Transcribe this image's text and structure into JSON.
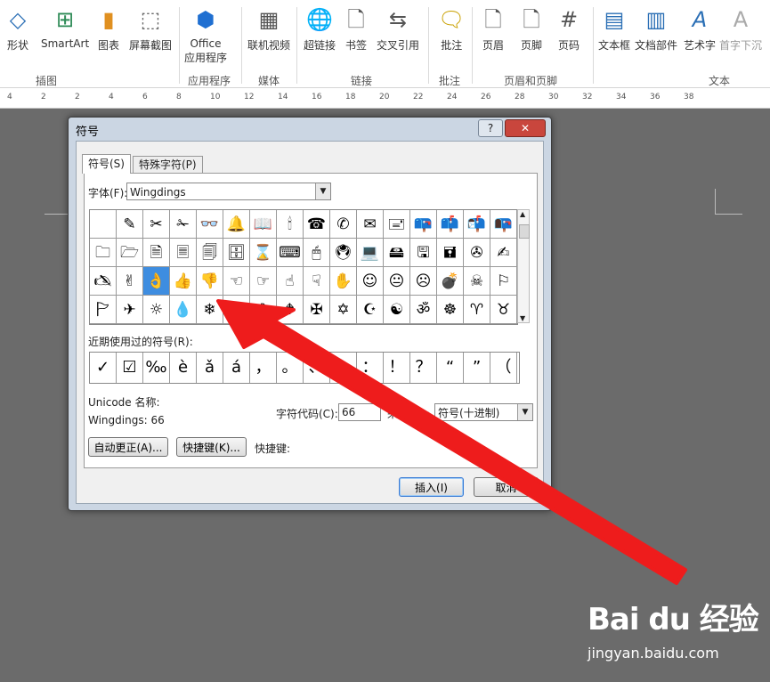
{
  "ribbon": {
    "buttons": [
      {
        "label": "形状",
        "icon": "shapes-icon"
      },
      {
        "label": "SmartArt",
        "icon": "smartart-icon"
      },
      {
        "label": "图表",
        "icon": "chart-icon"
      },
      {
        "label": "屏幕截图",
        "icon": "screenshot-icon"
      },
      {
        "label": "Office",
        "label2": "应用程序",
        "icon": "office-apps-icon"
      },
      {
        "label": "联机视频",
        "icon": "video-icon"
      },
      {
        "label": "超链接",
        "icon": "hyperlink-icon"
      },
      {
        "label": "书签",
        "icon": "bookmark-icon"
      },
      {
        "label": "交叉引用",
        "icon": "cross-reference-icon"
      },
      {
        "label": "批注",
        "icon": "comment-icon"
      },
      {
        "label": "页眉",
        "icon": "header-icon"
      },
      {
        "label": "页脚",
        "icon": "footer-icon"
      },
      {
        "label": "页码",
        "icon": "page-number-icon"
      },
      {
        "label": "文本框",
        "icon": "textbox-icon"
      },
      {
        "label": "文档部件",
        "icon": "quick-parts-icon"
      },
      {
        "label": "艺术字",
        "icon": "wordart-icon"
      },
      {
        "label": "首字下沉",
        "icon": "drop-cap-icon"
      }
    ],
    "groups": [
      "插图",
      "应用程序",
      "媒体",
      "链接",
      "批注",
      "页眉和页脚",
      "文本"
    ]
  },
  "ruler": {
    "ticks": [
      "4",
      "2",
      "2",
      "4",
      "6",
      "8",
      "10",
      "12",
      "14",
      "16",
      "18",
      "20",
      "22",
      "24",
      "26",
      "28",
      "30",
      "32",
      "34",
      "36",
      "38"
    ]
  },
  "dialog": {
    "title": "符号",
    "help_label": "?",
    "close_label": "✕",
    "tabs": [
      "符号(S)",
      "特殊字符(P)"
    ],
    "font_label": "字体(F):",
    "font_value": "Wingdings",
    "symbols": [
      "",
      "✎",
      "✂",
      "✁",
      "👓",
      "🔔",
      "📖",
      "🕯",
      "☎",
      "✆",
      "✉",
      "🖃",
      "📪",
      "📫",
      "📬",
      "📭",
      "🗀",
      "🗁",
      "🗎",
      "🗏",
      "🗐",
      "🗄",
      "⌛",
      "⌨",
      "🖱",
      "🖲",
      "💻",
      "🖴",
      "🖫",
      "🖬",
      "✇",
      "✍",
      "🖎",
      "✌",
      "👌",
      "👍",
      "👎",
      "☜",
      "☞",
      "☝",
      "☟",
      "✋",
      "☺",
      "😐",
      "☹",
      "💣",
      "☠",
      "⚐",
      "🏱",
      "✈",
      "☼",
      "💧",
      "❄",
      "🕆",
      "✞",
      "🕈",
      "✠",
      "✡",
      "☪",
      "☯",
      "ॐ",
      "☸",
      "♈",
      "♉"
    ],
    "selected_index": 34,
    "recent_label": "近期使用过的符号(R):",
    "recent": [
      "✓",
      "☑",
      "‰",
      "è",
      "ǎ",
      "á",
      "，",
      "。",
      "、",
      "；",
      "：",
      "！",
      "？",
      "“",
      "”",
      "（"
    ],
    "unicode_name_label": "Unicode 名称:",
    "font_code_text": "Wingdings: 66",
    "char_code_label": "字符代码(C):",
    "char_code_value": "66",
    "from_label": "来自(M):",
    "from_value": "符号(十进制)",
    "autocorrect_label": "自动更正(A)...",
    "shortcut_key_button_label": "快捷键(K)...",
    "shortcut_key_label": "快捷键:",
    "insert_label": "插入(I)",
    "cancel_label": "取消"
  },
  "watermark": {
    "logo": "Bai du 经验",
    "url": "jingyan.baidu.com"
  }
}
